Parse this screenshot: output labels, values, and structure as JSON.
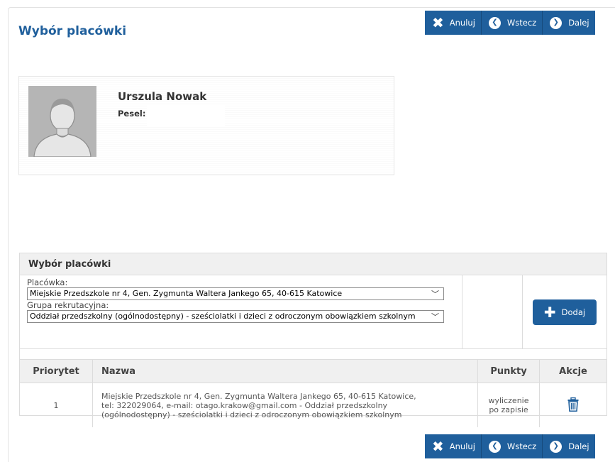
{
  "page": {
    "title": "Wybór placówki"
  },
  "toolbar": {
    "cancel": "Anuluj",
    "back": "Wstecz",
    "next": "Dalej"
  },
  "person": {
    "name": "Urszula Nowak",
    "pesel_label": "Pesel:"
  },
  "selection": {
    "header": "Wybór placówki",
    "placowka_label": "Placówka:",
    "placowka_value": "Miejskie Przedszkole nr 4, Gen. Zygmunta Waltera Jankego 65, 40-615 Katowice",
    "grupa_label": "Grupa rekrutacyjna:",
    "grupa_value": "Oddział przedszkolny (ogólnodostępny) - sześciolatki i dzieci z odroczonym obowiązkiem szkolnym",
    "add_label": "Dodaj"
  },
  "table": {
    "headers": [
      "Priorytet",
      "Nazwa",
      "Punkty",
      "Akcje"
    ],
    "rows": [
      {
        "priority": "1",
        "name_line1": "Miejskie Przedszkole nr 4, Gen. Zygmunta Waltera Jankego 65, 40-615 Katowice,",
        "name_line2": "tel: 322029064, e-mail: otago.krakow@gmail.com - Oddział przedszkolny",
        "name_line3": "(ogólnodostępny) - sześciolatki i dzieci z odroczonym obowiązkiem szkolnym",
        "points_line1": "wyliczenie",
        "points_line2": "po zapisie"
      }
    ]
  },
  "colors": {
    "primary": "#1f5f9c",
    "header_bg": "#f0f0f0",
    "avatar_bg": "#b5b5b5"
  },
  "icons": {
    "cancel": "x-icon",
    "back": "circle-arrow-left-icon",
    "next": "circle-arrow-right-icon",
    "add": "plus-icon",
    "delete": "trash-icon",
    "avatar": "user-silhouette-icon"
  }
}
